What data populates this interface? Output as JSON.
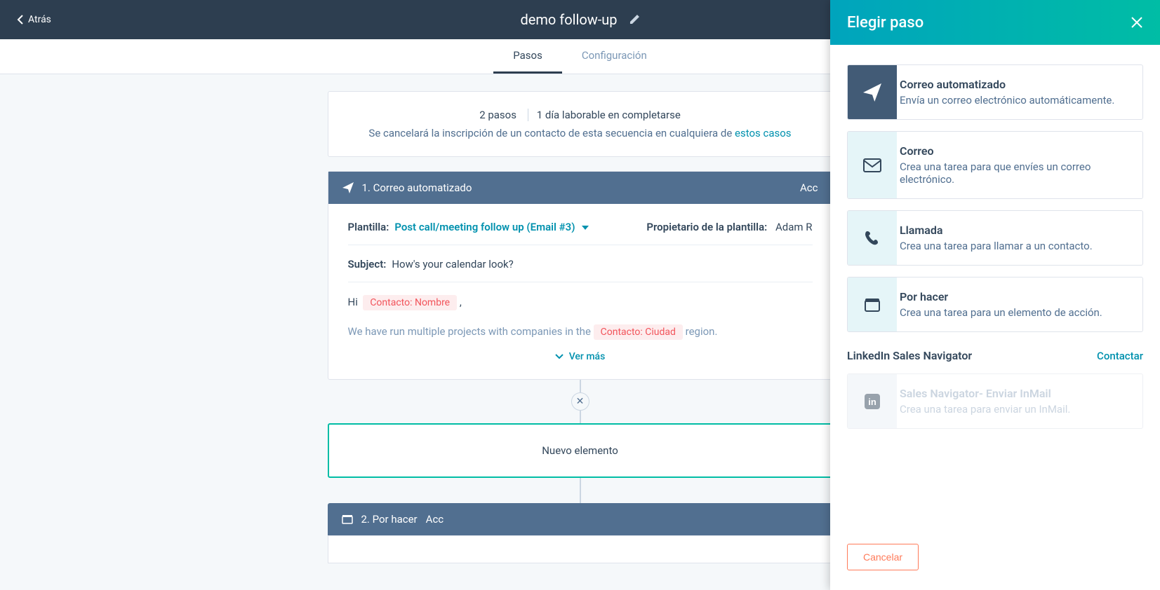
{
  "header": {
    "back": "Atrás",
    "title": "demo follow-up"
  },
  "tabs": {
    "steps": "Pasos",
    "config": "Configuración"
  },
  "summary": {
    "steps": "2 pasos",
    "duration": "1 día laborable en completarse",
    "unenroll_pre": "Se cancelará la inscripción de un contacto de esta secuencia en cualquiera de ",
    "unenroll_link": "estos casos"
  },
  "step1": {
    "title": "1. Correo automatizado",
    "actions": "Acc",
    "template_label": "Plantilla:",
    "template_name": "Post call/meeting follow up (Email #3)",
    "owner_label": "Propietario de la plantilla:",
    "owner_value": "Adam R",
    "subject_label": "Subject:",
    "subject": "How's your calendar look?",
    "body_hi": "Hi",
    "token_name": "Contacto: Nombre",
    "body_line2a": "We have run multiple projects with companies in the ",
    "token_city": "Contacto: Ciudad",
    "body_line2b": " region.",
    "see_more": "Ver más"
  },
  "new_element": "Nuevo elemento",
  "step2": {
    "title": "2. Por hacer",
    "actions": "Acc"
  },
  "panel": {
    "title": "Elegir paso",
    "options": [
      {
        "title": "Correo automatizado",
        "desc": "Envía un correo electrónico automáticamente.",
        "icon": "send"
      },
      {
        "title": "Correo",
        "desc": "Crea una tarea para que envíes un correo electrónico.",
        "icon": "mail"
      },
      {
        "title": "Llamada",
        "desc": "Crea una tarea para llamar a un contacto.",
        "icon": "phone"
      },
      {
        "title": "Por hacer",
        "desc": "Crea una tarea para un elemento de acción.",
        "icon": "todo"
      }
    ],
    "linkedin_label": "LinkedIn Sales Navigator",
    "linkedin_contact": "Contactar",
    "linkedin_option": {
      "title": "Sales Navigator- Enviar InMail",
      "desc": "Crea una tarea para enviar un InMail."
    },
    "cancel": "Cancelar"
  }
}
